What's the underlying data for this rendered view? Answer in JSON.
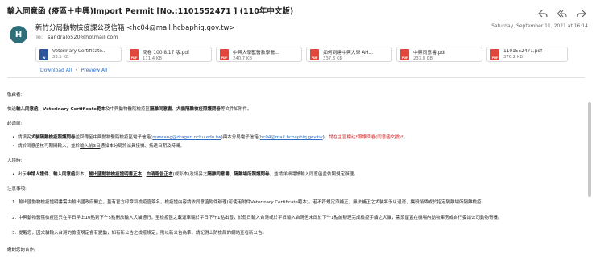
{
  "email": {
    "subject": "輸入同意函 (疫區＋中興)Import Permit [No.:1101552471 ] (110年中文版)",
    "avatar_letter": "H",
    "avatar_color": "#2f6f79",
    "from": "新竹分局動物檢疫課公務信箱 <hc04@mail.hcbaphiq.gov.tw>",
    "to_label": "To:",
    "to": "sandralo520@hotmail.com",
    "date": "Saturday, September 11, 2021 at 16:14"
  },
  "actions": {
    "reply_icon": "reply-icon",
    "reply_all_icon": "reply-all-icon",
    "forward_icon": "forward-icon"
  },
  "attachments": [
    {
      "name": "Veterinary Certificate...",
      "size": "33.5 KB",
      "type": "doc",
      "icon_label": "W"
    },
    {
      "name": "問卷 100.8.17 版.pdf",
      "size": "111.4 KB",
      "type": "pdf",
      "icon_label": "PDF"
    },
    {
      "name": "中興大學獸醫教學醫...",
      "size": "240.7 KB",
      "type": "pdf",
      "icon_label": "PDF"
    },
    {
      "name": "如何到達中興大學 AH...",
      "size": "337.3 KB",
      "type": "pdf",
      "icon_label": "PDF"
    },
    {
      "name": "中興同意書.pdf",
      "size": "233.8 KB",
      "type": "pdf",
      "icon_label": "PDF"
    },
    {
      "name": "1101552471.pdf",
      "size": "376.2 KB",
      "type": "pdf",
      "icon_label": "PDF"
    }
  ],
  "attachment_links": {
    "download_all": "Download All",
    "separator": "•",
    "preview_all": "Preview All"
  },
  "body": {
    "greeting": "敬啟者:",
    "intro_1": "檢送",
    "intro_2": "輸入同意函",
    "intro_3": "、",
    "intro_4": "Veterinary Certificate範本",
    "intro_5": "及中興動物醫院檢疫區",
    "intro_6": "隔離同意書",
    "intro_7": "、",
    "intro_8": "犬貓隔離檢疫照護問卷",
    "intro_9": "等文件如附件。",
    "before_heading": "起運前:",
    "before_1a": "請填妥",
    "before_1b": "犬貓隔離檢疫照護問卷",
    "before_1c": "並回傳至中興動物醫院檢疫區電子信箱(",
    "before_1d": "mwwang@dragon.nchu.edu.tw",
    "before_1e": ")與本分局電子信箱(",
    "before_1f": "hc04@mail.hcbaphiq.gov.tw",
    "before_1g": ")。",
    "before_1h": "請在主旨標註*照護問卷(同意函文號)*",
    "before_1i": "。",
    "before_2a": "請於同意函核可期間輸入，並於",
    "before_2b": "輸入前3日",
    "before_2c": "通知本分局將派員接機、抵達日期及時間。",
    "entry_heading": "入境時:",
    "entry_1a": "出示",
    "entry_1b": "申請人證件",
    "entry_1c": "、",
    "entry_1d": "輸入同意函",
    "entry_1e": "影本、",
    "entry_1f": "輸出國動物檢疫證明書正本",
    "entry_1g": "、",
    "entry_1h": "血清報告正本",
    "entry_1i": "(或影本)及填妥之",
    "entry_1j": "隔離同意書",
    "entry_1k": "、",
    "entry_1l": "隔離場所照護問卷",
    "entry_1m": "，並請詳細閱讀輸入同意函並依照規定辦理。",
    "notes_heading": "注意事項:",
    "note_1": "輸出國動物檢疫證明書需由輸出國政府開立，蓋有官方印章和檢疫官簽名，檢疫證內容請依同意函附件辦理(可使用附件Veterinary Certificate範本)。若不符規定須補正，無法補正之犬貓將予以退運，撲殺銷燬或於指定隔離場所隔離檢疫。",
    "note_2": "中興動物醫院檢疫區只在平日早上10點到下午5點開放輸入犬貓通行，至檢疫區之載運車輛於平日下午1點出發，於假日輸入台灣或於平日輸入台灣但未即於下午1點前辦理完成檢疫手續之犬貓，需須留置在機場內動物庫房或自行委請公司動物寄養。",
    "note_3": "提醒您，因犬貓輸入台灣的檢疫規定會有變動，如有新公告之檢疫規定，則以新公告為準，請記得上防檢局的網站查看新公告。",
    "closing": "謝謝您的合作。"
  }
}
